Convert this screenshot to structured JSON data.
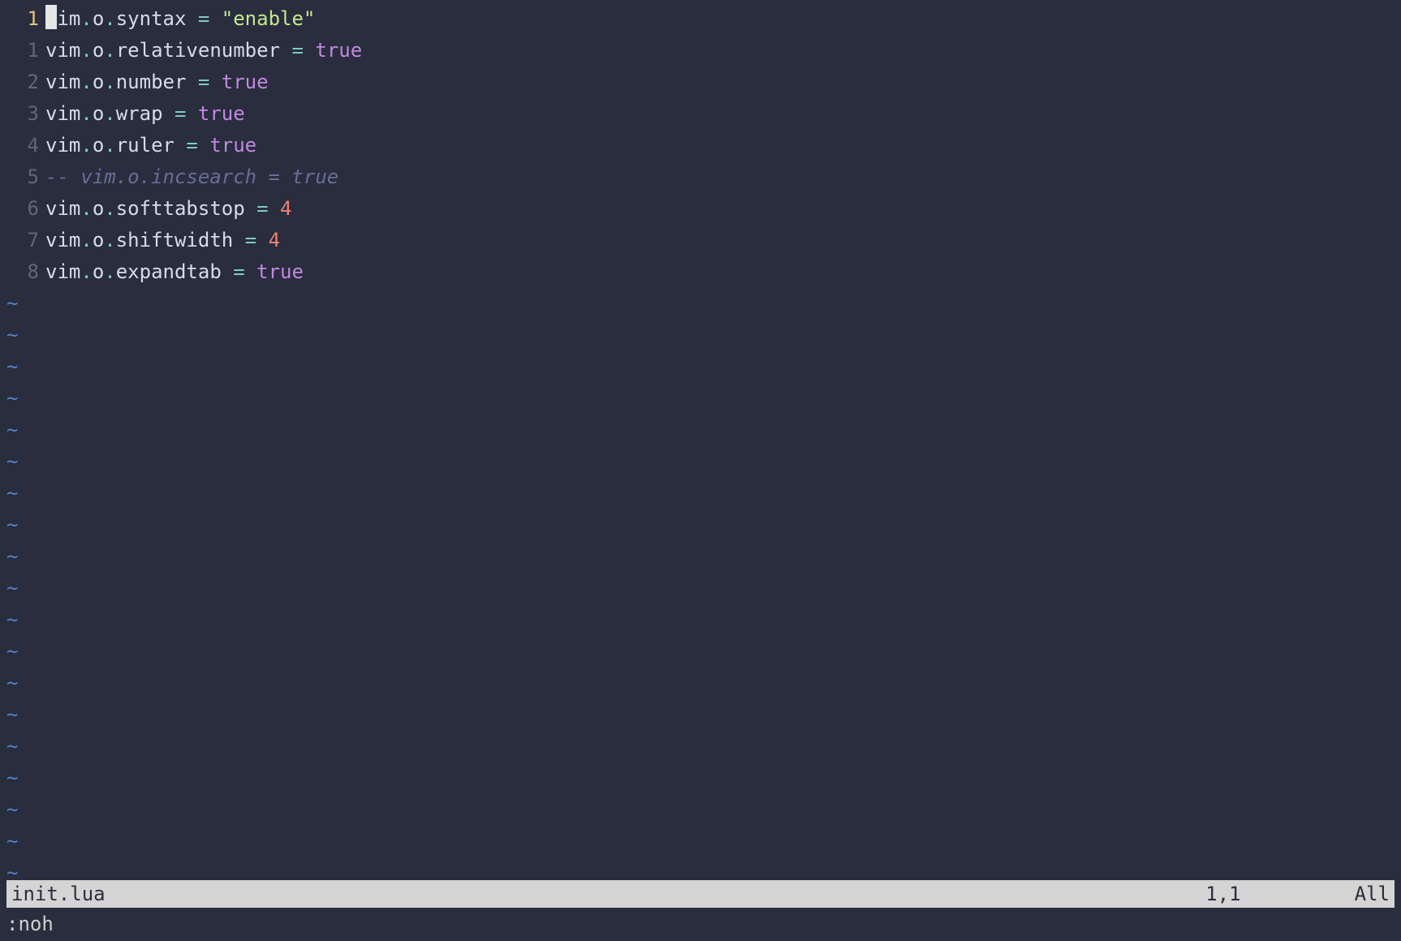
{
  "editor": {
    "cursor_line_abs": 1,
    "lines": [
      {
        "rel": "1",
        "current": true,
        "tokens": [
          {
            "t": "ident",
            "v": "vim"
          },
          {
            "t": "punct",
            "v": "."
          },
          {
            "t": "ident",
            "v": "o"
          },
          {
            "t": "punct",
            "v": "."
          },
          {
            "t": "ident",
            "v": "syntax"
          },
          {
            "t": "space",
            "v": " "
          },
          {
            "t": "op",
            "v": "="
          },
          {
            "t": "space",
            "v": " "
          },
          {
            "t": "string",
            "v": "\"enable\""
          }
        ]
      },
      {
        "rel": "1",
        "current": false,
        "tokens": [
          {
            "t": "ident",
            "v": "vim"
          },
          {
            "t": "punct",
            "v": "."
          },
          {
            "t": "ident",
            "v": "o"
          },
          {
            "t": "punct",
            "v": "."
          },
          {
            "t": "ident",
            "v": "relativenumber"
          },
          {
            "t": "space",
            "v": " "
          },
          {
            "t": "op",
            "v": "="
          },
          {
            "t": "space",
            "v": " "
          },
          {
            "t": "bool",
            "v": "true"
          }
        ]
      },
      {
        "rel": "2",
        "current": false,
        "tokens": [
          {
            "t": "ident",
            "v": "vim"
          },
          {
            "t": "punct",
            "v": "."
          },
          {
            "t": "ident",
            "v": "o"
          },
          {
            "t": "punct",
            "v": "."
          },
          {
            "t": "ident",
            "v": "number"
          },
          {
            "t": "space",
            "v": " "
          },
          {
            "t": "op",
            "v": "="
          },
          {
            "t": "space",
            "v": " "
          },
          {
            "t": "bool",
            "v": "true"
          }
        ]
      },
      {
        "rel": "3",
        "current": false,
        "tokens": [
          {
            "t": "ident",
            "v": "vim"
          },
          {
            "t": "punct",
            "v": "."
          },
          {
            "t": "ident",
            "v": "o"
          },
          {
            "t": "punct",
            "v": "."
          },
          {
            "t": "ident",
            "v": "wrap"
          },
          {
            "t": "space",
            "v": " "
          },
          {
            "t": "op",
            "v": "="
          },
          {
            "t": "space",
            "v": " "
          },
          {
            "t": "bool",
            "v": "true"
          }
        ]
      },
      {
        "rel": "4",
        "current": false,
        "tokens": [
          {
            "t": "ident",
            "v": "vim"
          },
          {
            "t": "punct",
            "v": "."
          },
          {
            "t": "ident",
            "v": "o"
          },
          {
            "t": "punct",
            "v": "."
          },
          {
            "t": "ident",
            "v": "ruler"
          },
          {
            "t": "space",
            "v": " "
          },
          {
            "t": "op",
            "v": "="
          },
          {
            "t": "space",
            "v": " "
          },
          {
            "t": "bool",
            "v": "true"
          }
        ]
      },
      {
        "rel": "5",
        "current": false,
        "tokens": [
          {
            "t": "comment",
            "v": "-- vim.o.incsearch = true"
          }
        ]
      },
      {
        "rel": "6",
        "current": false,
        "tokens": [
          {
            "t": "ident",
            "v": "vim"
          },
          {
            "t": "punct",
            "v": "."
          },
          {
            "t": "ident",
            "v": "o"
          },
          {
            "t": "punct",
            "v": "."
          },
          {
            "t": "ident",
            "v": "softtabstop"
          },
          {
            "t": "space",
            "v": " "
          },
          {
            "t": "op",
            "v": "="
          },
          {
            "t": "space",
            "v": " "
          },
          {
            "t": "number",
            "v": "4"
          }
        ]
      },
      {
        "rel": "7",
        "current": false,
        "tokens": [
          {
            "t": "ident",
            "v": "vim"
          },
          {
            "t": "punct",
            "v": "."
          },
          {
            "t": "ident",
            "v": "o"
          },
          {
            "t": "punct",
            "v": "."
          },
          {
            "t": "ident",
            "v": "shiftwidth"
          },
          {
            "t": "space",
            "v": " "
          },
          {
            "t": "op",
            "v": "="
          },
          {
            "t": "space",
            "v": " "
          },
          {
            "t": "number",
            "v": "4"
          }
        ]
      },
      {
        "rel": "8",
        "current": false,
        "tokens": [
          {
            "t": "ident",
            "v": "vim"
          },
          {
            "t": "punct",
            "v": "."
          },
          {
            "t": "ident",
            "v": "o"
          },
          {
            "t": "punct",
            "v": "."
          },
          {
            "t": "ident",
            "v": "expandtab"
          },
          {
            "t": "space",
            "v": " "
          },
          {
            "t": "op",
            "v": "="
          },
          {
            "t": "space",
            "v": " "
          },
          {
            "t": "bool",
            "v": "true"
          }
        ]
      }
    ],
    "tilde_rows": 19,
    "tilde_char": "~"
  },
  "statusbar": {
    "filename": "init.lua",
    "position": "1,1",
    "percent": "All"
  },
  "cmdline": ":noh"
}
